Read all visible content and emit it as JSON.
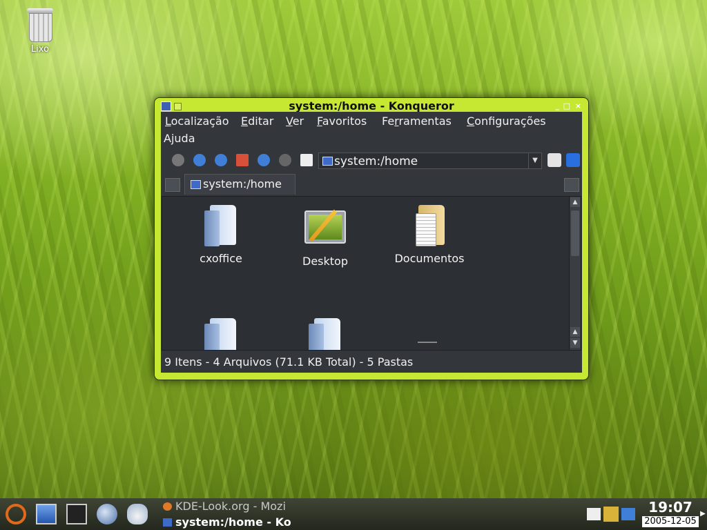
{
  "desktop": {
    "trash_label": "Lixo"
  },
  "window": {
    "title": "system:/home - Konqueror",
    "menu": {
      "localizacao": "Localização",
      "editar": "Editar",
      "ver": "Ver",
      "favoritos": "Favoritos",
      "ferramentas": "Ferramentas",
      "configuracoes": "Configurações",
      "ajuda": "Ajuda"
    },
    "location": {
      "value": "system:/home"
    },
    "tab": {
      "label": "system:/home"
    },
    "items": [
      {
        "label": "cxoffice",
        "icon": "folder-icon"
      },
      {
        "label": "Desktop",
        "icon": "desktop-icon"
      },
      {
        "label": "Documentos",
        "icon": "documents-folder-icon"
      },
      {
        "label": "",
        "icon": "folder-icon"
      },
      {
        "label": "",
        "icon": "folder-icon"
      }
    ],
    "status": "9 Itens - 4 Arquivos (71.1 KB Total) - 5 Pastas"
  },
  "taskbar": {
    "tasks": [
      {
        "label": "KDE-Look.org - Mozi",
        "active": false
      },
      {
        "label": "system:/home - Ko",
        "active": true
      }
    ],
    "clock": {
      "time": "19:07",
      "date": "2005-12-05"
    }
  },
  "colors": {
    "window_frame": "#c6e832",
    "window_bg": "#33373c",
    "accent_blue": "#3f6ac8"
  }
}
